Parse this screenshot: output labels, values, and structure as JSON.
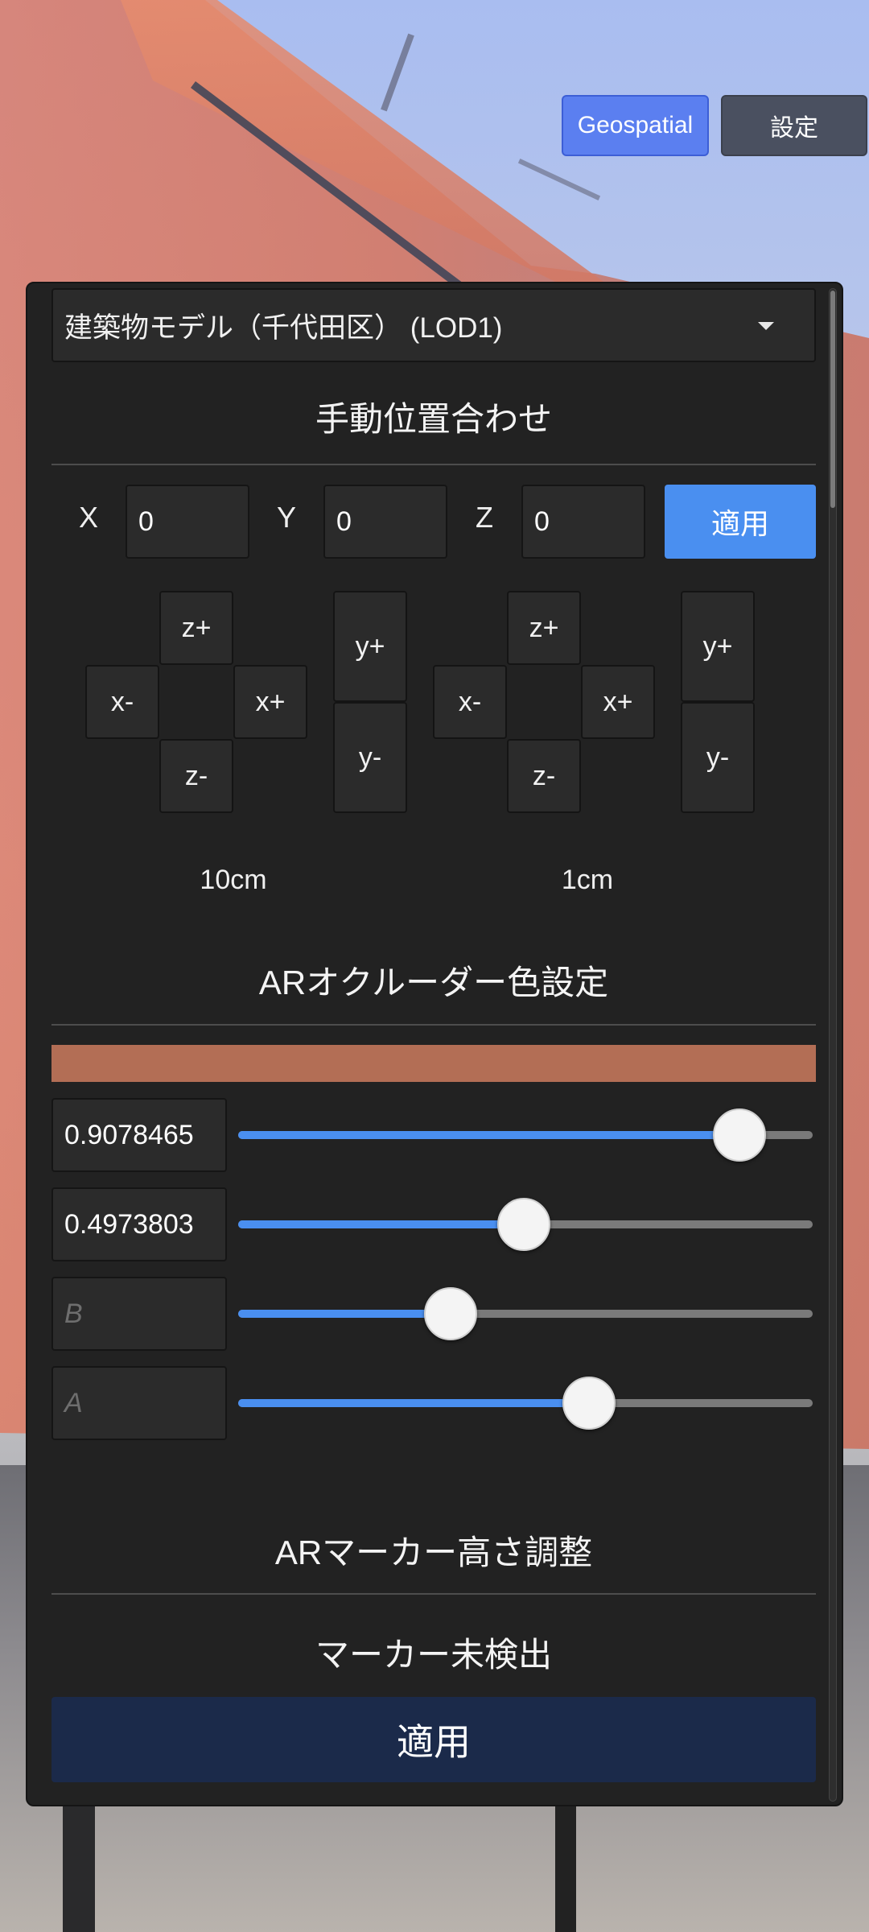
{
  "top_buttons": {
    "geospatial": "Geospatial",
    "settings": "設定"
  },
  "dropdown": {
    "selected": "建築物モデル（千代田区） (LOD1)"
  },
  "manual_alignment": {
    "title": "手動位置合わせ",
    "x_label": "X",
    "x_value": "0",
    "y_label": "Y",
    "y_value": "0",
    "z_label": "Z",
    "z_value": "0",
    "apply": "適用"
  },
  "pads": [
    {
      "step_label": "10cm",
      "z_plus": "z+",
      "x_minus": "x-",
      "x_plus": "x+",
      "z_minus": "z-",
      "y_plus": "y+",
      "y_minus": "y-"
    },
    {
      "step_label": "1cm",
      "z_plus": "z+",
      "x_minus": "x-",
      "x_plus": "x+",
      "z_minus": "z-",
      "y_plus": "y+",
      "y_minus": "y-"
    }
  ],
  "occluder_color": {
    "title": "ARオクルーダー色設定",
    "preview_color": "#b36e55",
    "channels": [
      {
        "value": "0.9078465",
        "placeholder": "",
        "level": 0.873
      },
      {
        "value": "0.4973803",
        "placeholder": "",
        "level": 0.497
      },
      {
        "value": "",
        "placeholder": "B",
        "level": 0.37
      },
      {
        "value": "",
        "placeholder": "A",
        "level": 0.61
      }
    ]
  },
  "marker_height": {
    "title": "ARマーカー高さ調整",
    "status": "マーカー未検出",
    "apply": "適用"
  },
  "colors": {
    "accent": "#4a8ff0",
    "panel": "#222222",
    "geospatial_button": "#5b7ff0",
    "apply_dark": "#1b2a4a"
  }
}
